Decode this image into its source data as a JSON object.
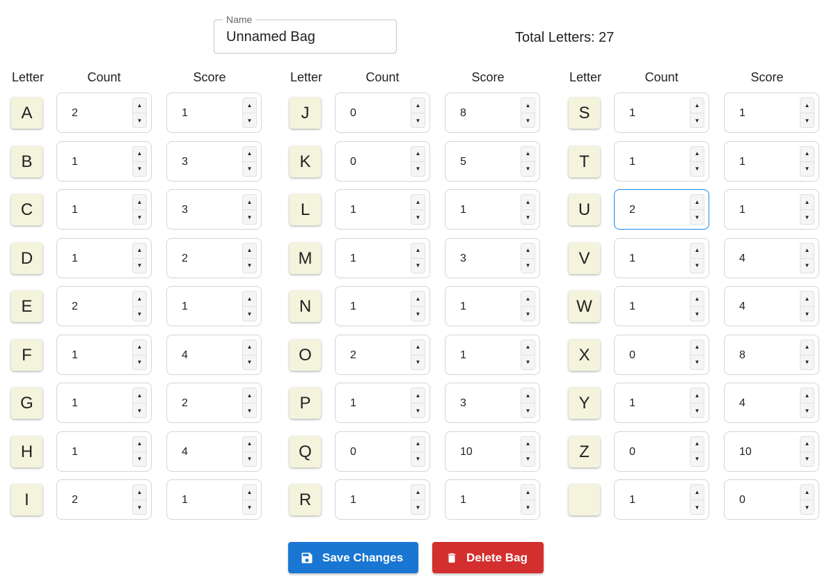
{
  "name_field": {
    "label": "Name",
    "value": "Unnamed Bag"
  },
  "total": {
    "text": "Total Letters: 27"
  },
  "headers": {
    "letter": "Letter",
    "count": "Count",
    "score": "Score"
  },
  "letters": [
    {
      "letter": "A",
      "count": "2",
      "score": "1"
    },
    {
      "letter": "B",
      "count": "1",
      "score": "3"
    },
    {
      "letter": "C",
      "count": "1",
      "score": "3"
    },
    {
      "letter": "D",
      "count": "1",
      "score": "2"
    },
    {
      "letter": "E",
      "count": "2",
      "score": "1"
    },
    {
      "letter": "F",
      "count": "1",
      "score": "4"
    },
    {
      "letter": "G",
      "count": "1",
      "score": "2"
    },
    {
      "letter": "H",
      "count": "1",
      "score": "4"
    },
    {
      "letter": "I",
      "count": "2",
      "score": "1"
    },
    {
      "letter": "J",
      "count": "0",
      "score": "8"
    },
    {
      "letter": "K",
      "count": "0",
      "score": "5"
    },
    {
      "letter": "L",
      "count": "1",
      "score": "1"
    },
    {
      "letter": "M",
      "count": "1",
      "score": "3"
    },
    {
      "letter": "N",
      "count": "1",
      "score": "1"
    },
    {
      "letter": "O",
      "count": "2",
      "score": "1"
    },
    {
      "letter": "P",
      "count": "1",
      "score": "3"
    },
    {
      "letter": "Q",
      "count": "0",
      "score": "10"
    },
    {
      "letter": "R",
      "count": "1",
      "score": "1"
    },
    {
      "letter": "S",
      "count": "1",
      "score": "1"
    },
    {
      "letter": "T",
      "count": "1",
      "score": "1"
    },
    {
      "letter": "U",
      "count": "2",
      "score": "1",
      "focused": true
    },
    {
      "letter": "V",
      "count": "1",
      "score": "4"
    },
    {
      "letter": "W",
      "count": "1",
      "score": "4"
    },
    {
      "letter": "X",
      "count": "0",
      "score": "8"
    },
    {
      "letter": "Y",
      "count": "1",
      "score": "4"
    },
    {
      "letter": "Z",
      "count": "0",
      "score": "10"
    },
    {
      "letter": "",
      "count": "1",
      "score": "0"
    }
  ],
  "buttons": {
    "save": {
      "label": "Save Changes",
      "icon": "floppy-disk-icon",
      "color": "#1976d2"
    },
    "delete": {
      "label": "Delete Bag",
      "icon": "trash-icon",
      "color": "#d32f2f"
    }
  },
  "colors": {
    "tile": "#f4f3dc",
    "focus": "#1e88e5"
  }
}
